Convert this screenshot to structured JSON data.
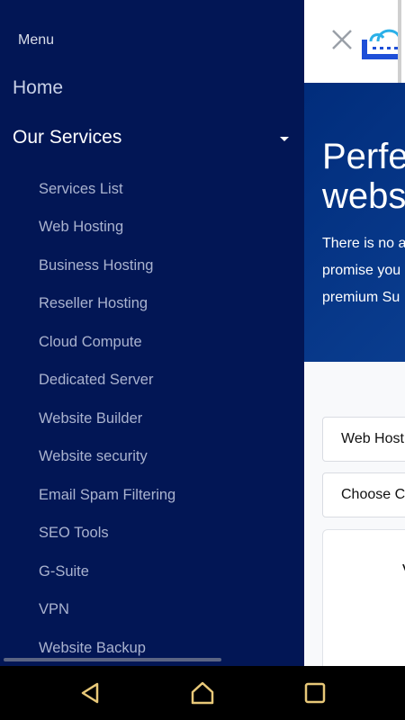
{
  "drawer": {
    "menu_label": "Menu",
    "home": "Home",
    "services": "Our Services",
    "services_items": [
      "Services List",
      "Web Hosting",
      "Business Hosting",
      "Reseller Hosting",
      "Cloud Compute",
      "Dedicated Server",
      "Website Builder",
      "Website security",
      "Email Spam Filtering",
      "SEO Tools",
      "G-Suite",
      "VPN",
      "Website Backup"
    ]
  },
  "page": {
    "hero_title_line1": "Perfe",
    "hero_title_line2": "webs",
    "hero_text_line1": "There is no a",
    "hero_text_line2": "promise you",
    "hero_text_line3": "premium Su",
    "select1_value": "Web Host",
    "select2_value": "Choose C",
    "card_partial_text": "V"
  },
  "icons": {
    "close": "close-icon",
    "logo": "cloud-logo-icon",
    "back": "back-icon",
    "home": "home-icon",
    "recents": "recents-icon"
  },
  "colors": {
    "drawer_bg": "#021655",
    "hero_bg": "#0a2a8a",
    "navbar_bg": "#000000",
    "navbar_icon": "#e8c878"
  }
}
